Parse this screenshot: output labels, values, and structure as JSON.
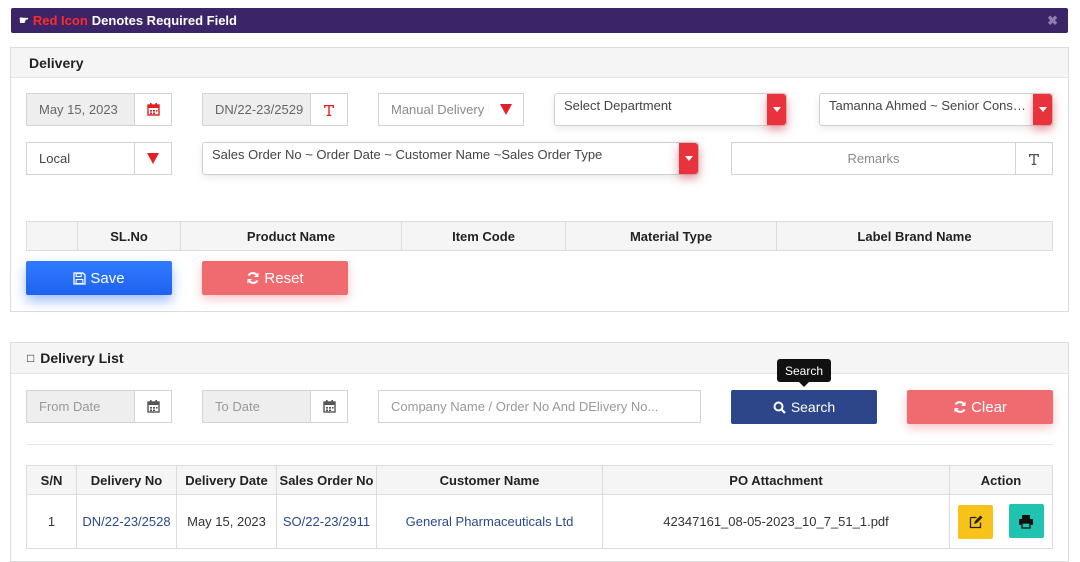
{
  "notice": {
    "hand": "☛",
    "red_text": "Red Icon",
    "text": "Denotes Required Field",
    "close": "✖"
  },
  "delivery": {
    "title": "Delivery",
    "date": "May 15, 2023",
    "dn_no": "DN/22-23/2529",
    "manual_placeholder": "Manual Delivery No",
    "department": "Select Department",
    "employee": "Tamanna Ahmed ~ Senior Consultant",
    "location": "Local",
    "sales_order": "Sales Order No ~ Order Date ~ Customer Name ~Sales Order Type",
    "remarks_placeholder": "Remarks",
    "columns": [
      "",
      "SL.No",
      "Product Name",
      "Item Code",
      "Material Type",
      "Label Brand Name"
    ],
    "save_label": "Save",
    "reset_label": "Reset"
  },
  "list": {
    "title": "Delivery List",
    "title_icon": "□",
    "from_placeholder": "From Date",
    "to_placeholder": "To Date",
    "search_placeholder": "Company Name / Order No And DElivery No...",
    "search_label": "Search",
    "tooltip": "Search",
    "clear_label": "Clear",
    "columns": [
      "S/N",
      "Delivery No",
      "Delivery Date",
      "Sales Order No",
      "Customer Name",
      "PO Attachment",
      "Action"
    ],
    "rows": [
      {
        "sn": "1",
        "delivery_no": "DN/22-23/2528",
        "delivery_date": "May 15, 2023",
        "sales_order_no": "SO/22-23/2911",
        "customer": "General Pharmaceuticals Ltd",
        "attachment": "42347161_08-05-2023_10_7_51_1.pdf"
      }
    ]
  },
  "colors": {
    "brand": "#3b2468",
    "required": "#e3202a",
    "primary": "#1f62f0",
    "danger": "#ef6b70",
    "navy": "#2d468a"
  }
}
